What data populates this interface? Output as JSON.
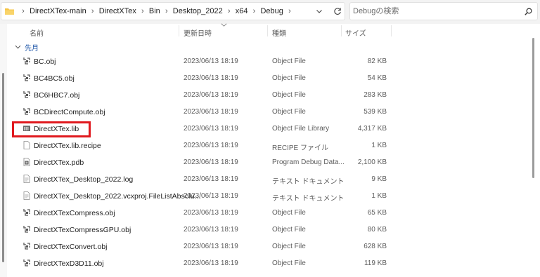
{
  "address": {
    "crumbs": [
      "DirectXTex-main",
      "DirectXTex",
      "Bin",
      "Desktop_2022",
      "x64",
      "Debug"
    ],
    "separator": "›"
  },
  "search": {
    "placeholder": "Debugの検索"
  },
  "columns": {
    "name": "名前",
    "date": "更新日時",
    "type": "種類",
    "size": "サイズ"
  },
  "group": {
    "label": "先月"
  },
  "files": [
    {
      "name": "BC.obj",
      "date": "2023/06/13 18:19",
      "type": "Object File",
      "size": "82 KB",
      "icon": "object-file-icon"
    },
    {
      "name": "BC4BC5.obj",
      "date": "2023/06/13 18:19",
      "type": "Object File",
      "size": "54 KB",
      "icon": "object-file-icon"
    },
    {
      "name": "BC6HBC7.obj",
      "date": "2023/06/13 18:19",
      "type": "Object File",
      "size": "283 KB",
      "icon": "object-file-icon"
    },
    {
      "name": "BCDirectCompute.obj",
      "date": "2023/06/13 18:19",
      "type": "Object File",
      "size": "539 KB",
      "icon": "object-file-icon"
    },
    {
      "name": "DirectXTex.lib",
      "date": "2023/06/13 18:19",
      "type": "Object File Library",
      "size": "4,317 KB",
      "icon": "library-file-icon"
    },
    {
      "name": "DirectXTex.lib.recipe",
      "date": "2023/06/13 18:19",
      "type": "RECIPE ファイル",
      "size": "1 KB",
      "icon": "blank-file-icon"
    },
    {
      "name": "DirectXTex.pdb",
      "date": "2023/06/13 18:19",
      "type": "Program Debug Data...",
      "size": "2,100 KB",
      "icon": "pdb-file-icon"
    },
    {
      "name": "DirectXTex_Desktop_2022.log",
      "date": "2023/06/13 18:19",
      "type": "テキスト ドキュメント",
      "size": "9 KB",
      "icon": "text-file-icon"
    },
    {
      "name": "DirectXTex_Desktop_2022.vcxproj.FileListAbsolu...",
      "date": "2023/06/13 18:19",
      "type": "テキスト ドキュメント",
      "size": "1 KB",
      "icon": "text-file-icon"
    },
    {
      "name": "DirectXTexCompress.obj",
      "date": "2023/06/13 18:19",
      "type": "Object File",
      "size": "65 KB",
      "icon": "object-file-icon"
    },
    {
      "name": "DirectXTexCompressGPU.obj",
      "date": "2023/06/13 18:19",
      "type": "Object File",
      "size": "80 KB",
      "icon": "object-file-icon"
    },
    {
      "name": "DirectXTexConvert.obj",
      "date": "2023/06/13 18:19",
      "type": "Object File",
      "size": "628 KB",
      "icon": "object-file-icon"
    },
    {
      "name": "DirectXTexD3D11.obj",
      "date": "2023/06/13 18:19",
      "type": "Object File",
      "size": "119 KB",
      "icon": "object-file-icon"
    }
  ],
  "highlight": {
    "file": "DirectXTex.lib",
    "color": "#e0191e"
  },
  "colors": {
    "folder": "#f6c445",
    "group_label": "#1f56a8"
  }
}
